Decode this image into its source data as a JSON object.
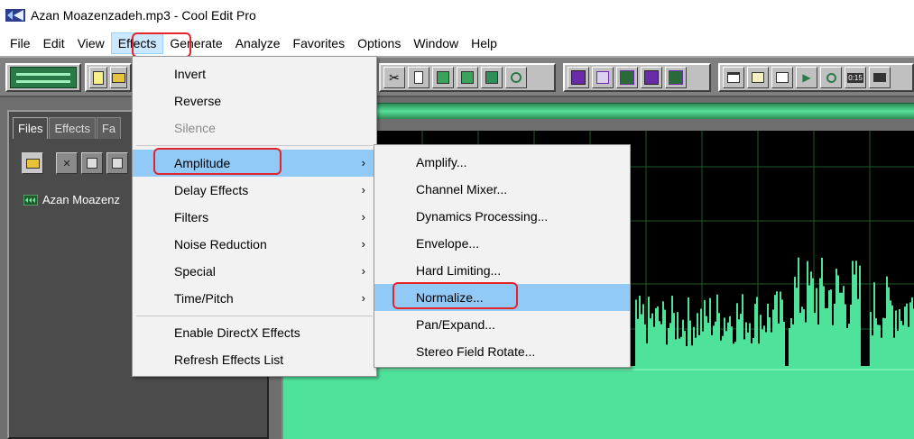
{
  "window": {
    "title": "Azan Moazenzadeh.mp3 - Cool Edit Pro"
  },
  "menubar": {
    "items": [
      "File",
      "Edit",
      "View",
      "Effects",
      "Generate",
      "Analyze",
      "Favorites",
      "Options",
      "Window",
      "Help"
    ],
    "active": "Effects"
  },
  "left_panel": {
    "tabs": [
      "Files",
      "Effects",
      "Fa"
    ],
    "files": [
      "Azan Moazenz"
    ]
  },
  "effects_menu": {
    "items": [
      {
        "label": "Invert",
        "submenu": false,
        "enabled": true
      },
      {
        "label": "Reverse",
        "submenu": false,
        "enabled": true
      },
      {
        "label": "Silence",
        "submenu": false,
        "enabled": false
      },
      {
        "label": "Amplitude",
        "submenu": true,
        "enabled": true
      },
      {
        "label": "Delay Effects",
        "submenu": true,
        "enabled": true
      },
      {
        "label": "Filters",
        "submenu": true,
        "enabled": true
      },
      {
        "label": "Noise Reduction",
        "submenu": true,
        "enabled": true
      },
      {
        "label": "Special",
        "submenu": true,
        "enabled": true
      },
      {
        "label": "Time/Pitch",
        "submenu": true,
        "enabled": true
      },
      {
        "label": "Enable DirectX Effects",
        "submenu": false,
        "enabled": true
      },
      {
        "label": "Refresh Effects List",
        "submenu": false,
        "enabled": true
      }
    ],
    "highlighted": "Amplitude",
    "submenu_arrow": "›"
  },
  "amplitude_menu": {
    "items": [
      "Amplify...",
      "Channel Mixer...",
      "Dynamics Processing...",
      "Envelope...",
      "Hard Limiting...",
      "Normalize...",
      "Pan/Expand...",
      "Stereo Field Rotate..."
    ],
    "highlighted": "Normalize..."
  },
  "toolbar": {
    "time_button_label": "0:15"
  },
  "colors": {
    "highlight": "#91c9f7",
    "annotation": "#e3242b",
    "waveform": "#4ee29a",
    "grid": "#1f5a2a"
  }
}
